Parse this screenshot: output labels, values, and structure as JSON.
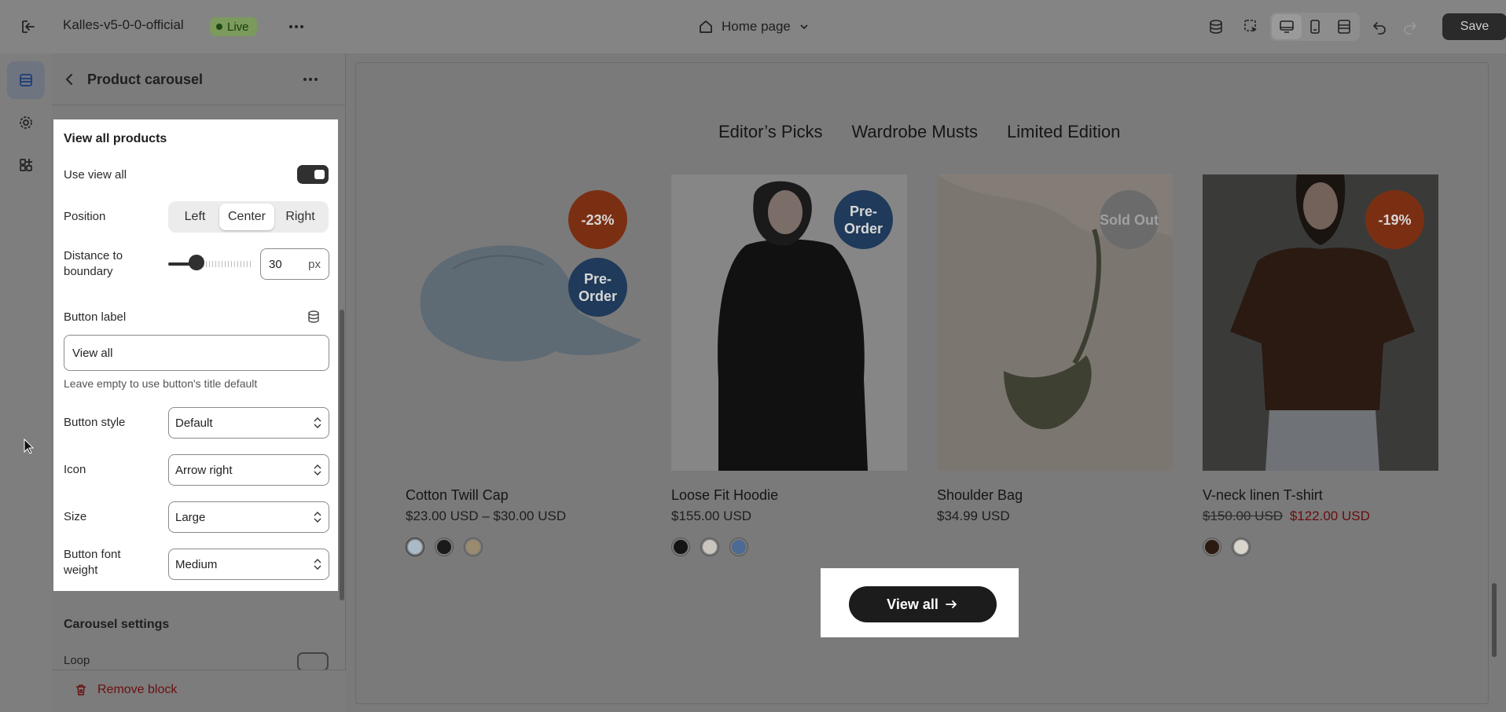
{
  "topbar": {
    "store_name": "Kalles-v5-0-0-official",
    "live_label": "Live",
    "page_name": "Home page",
    "save_label": "Save"
  },
  "sidebar": {
    "title": "Product carousel",
    "panel": {
      "heading": "View all products",
      "use_view_all_label": "Use view all",
      "use_view_all_on": true,
      "position_label": "Position",
      "position_options": [
        "Left",
        "Center",
        "Right"
      ],
      "position_selected": "Center",
      "distance_label": "Distance to boundary",
      "distance_value": "30",
      "distance_unit": "px",
      "button_label_label": "Button label",
      "button_label_value": "View all",
      "button_label_help": "Leave empty to use button's title default",
      "button_style_label": "Button style",
      "button_style_value": "Default",
      "icon_label": "Icon",
      "icon_value": "Arrow right",
      "size_label": "Size",
      "size_value": "Large",
      "font_weight_label": "Button font weight",
      "font_weight_value": "Medium"
    },
    "carousel_heading": "Carousel settings",
    "loop_label": "Loop",
    "remove_block_label": "Remove block"
  },
  "preview": {
    "tabs": [
      "Editor’s Picks",
      "Wardrobe Musts",
      "Limited Edition"
    ],
    "products": [
      {
        "title": "Cotton Twill Cap",
        "price": "$23.00 USD – $30.00 USD",
        "badges": [
          "-23%",
          "Pre-Order"
        ],
        "swatches": [
          "#a9b9c6",
          "#1a1a1a",
          "#9a8a6e"
        ]
      },
      {
        "title": "Loose Fit Hoodie",
        "price": "$155.00 USD",
        "badges": [
          "Pre-Order"
        ],
        "swatches": [
          "#141414",
          "#c9c4bd",
          "#4d6a94"
        ]
      },
      {
        "title": "Shoulder Bag",
        "price": "$34.99 USD",
        "badges": [
          "Sold Out"
        ],
        "swatches": []
      },
      {
        "title": "V-neck linen T-shirt",
        "old_price": "$150.00 USD",
        "new_price": "$122.00 USD",
        "badges": [
          "-19%"
        ],
        "swatches": [
          "#2c1a12",
          "#d9d4cc"
        ]
      }
    ],
    "view_all_label": "View all"
  },
  "colors": {
    "sale_badge": "#7b2f12",
    "preorder_badge": "#1f3a5a",
    "soldout_badge": "#6b6b6b",
    "sale_price": "#6a0d0d",
    "live_badge": "#7b9a5c"
  }
}
